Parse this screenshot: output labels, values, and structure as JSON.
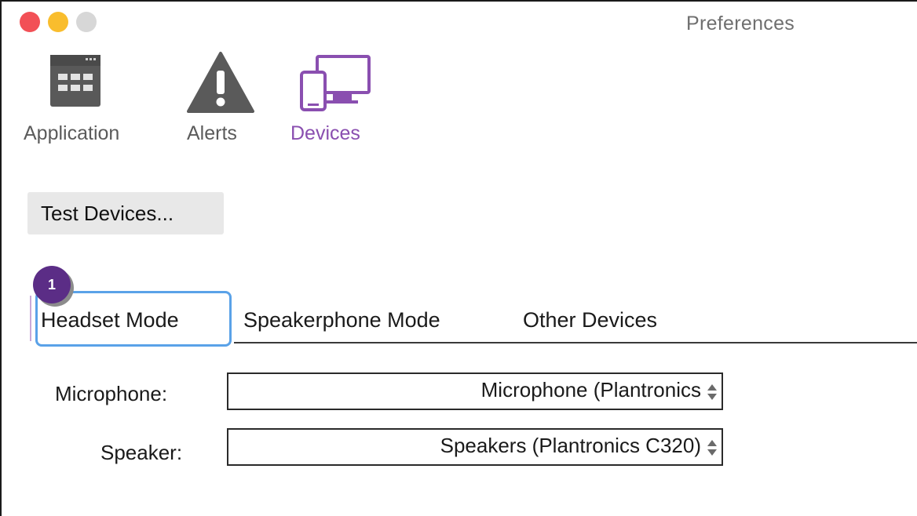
{
  "window": {
    "title": "Preferences"
  },
  "toolbar": {
    "items": [
      {
        "label": "Application",
        "icon": "calendar-grid-icon"
      },
      {
        "label": "Alerts",
        "icon": "warning-triangle-icon"
      },
      {
        "label": "Devices",
        "icon": "devices-monitor-phone-icon",
        "selected": true
      }
    ]
  },
  "test_devices_button": {
    "label": "Test Devices..."
  },
  "tabs": [
    {
      "label": "Headset Mode",
      "selected": true
    },
    {
      "label": "Speakerphone Mode"
    },
    {
      "label": "Other Devices"
    }
  ],
  "callout": {
    "number": "1"
  },
  "form": {
    "microphone": {
      "label": "Microphone:",
      "value": "Microphone (Plantronics"
    },
    "speaker": {
      "label": "Speaker:",
      "value": "Speakers (Plantronics C320)"
    }
  },
  "colors": {
    "accent_purple": "#8a4fb0",
    "badge_purple": "#5b2d86",
    "highlight_blue": "#5aa2e8",
    "close": "#f25056",
    "minimize": "#f9bd2d",
    "zoom_inactive": "#d7d7d7"
  }
}
